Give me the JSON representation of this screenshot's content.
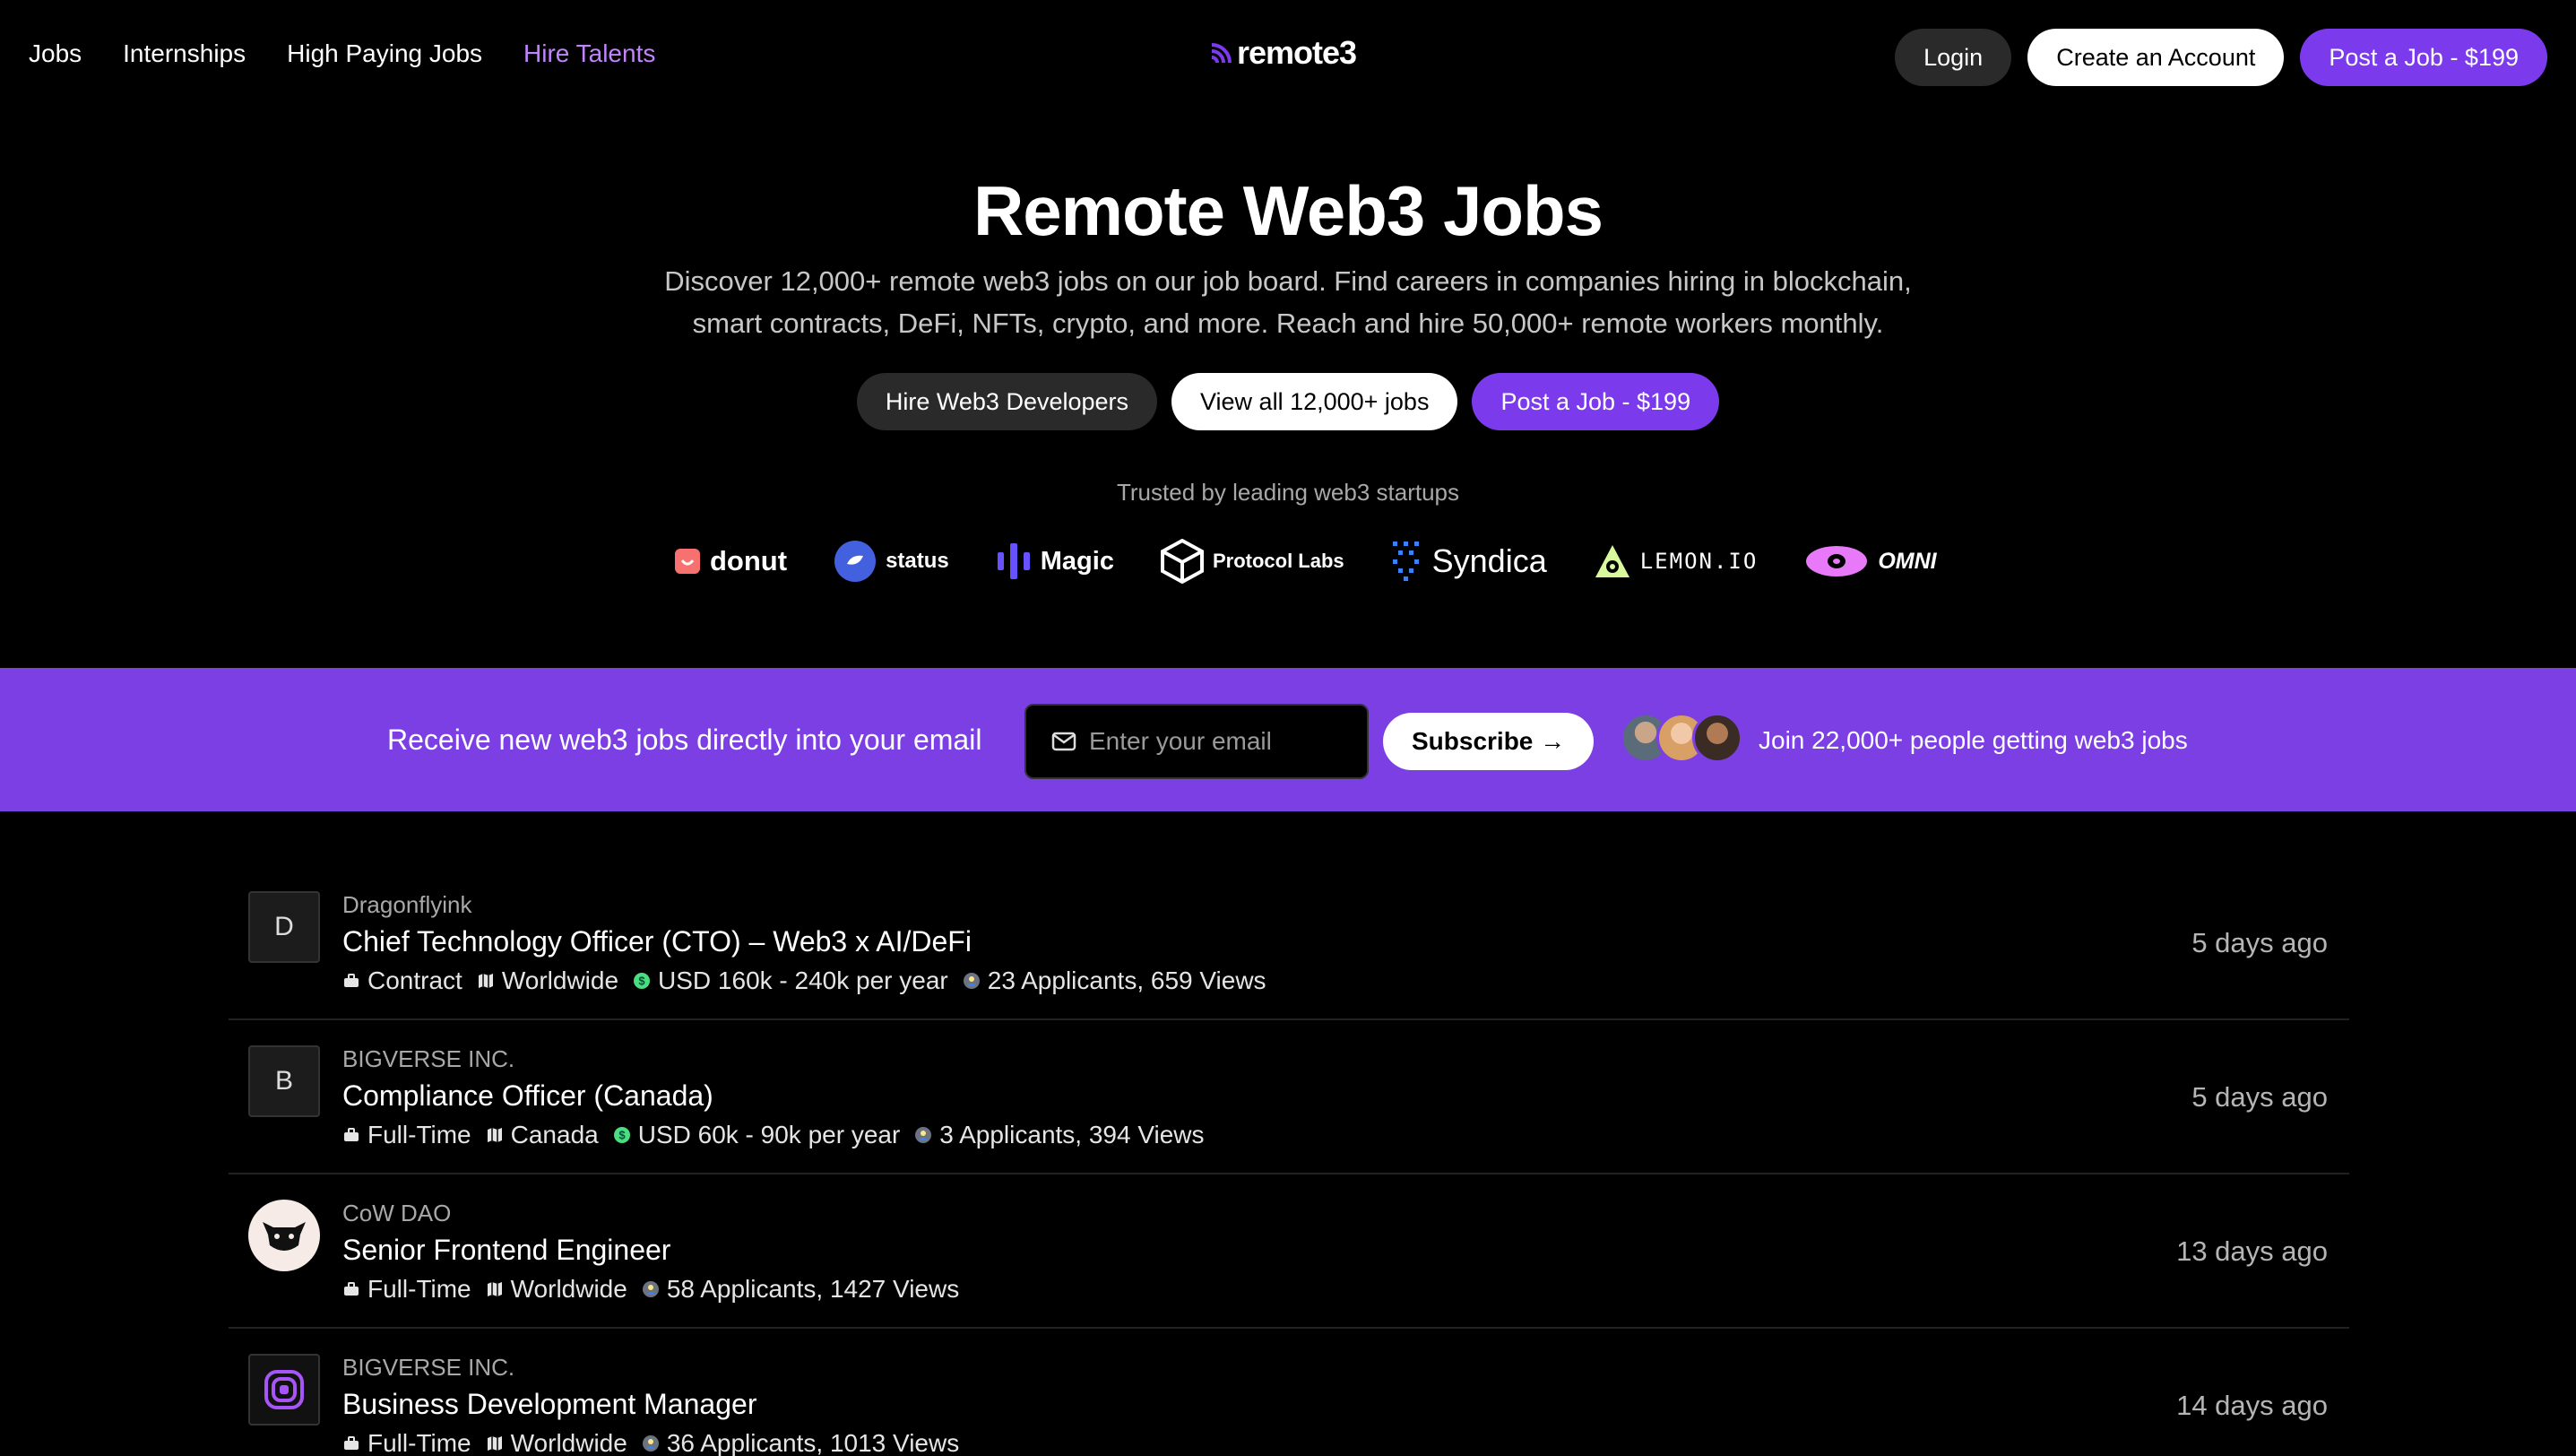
{
  "nav": {
    "links": [
      "Jobs",
      "Internships",
      "High Paying Jobs",
      "Hire Talents"
    ],
    "logo_text": "remote3",
    "login": "Login",
    "create_account": "Create an Account",
    "post_job": "Post a Job - $199"
  },
  "hero": {
    "title": "Remote Web3 Jobs",
    "subtitle_line1": "Discover 12,000+ remote web3 jobs on our job board. Find careers in companies hiring in blockchain,",
    "subtitle_line2": "smart contracts, DeFi, NFTs, crypto, and more. Reach and hire 50,000+ remote workers monthly.",
    "btn_hire": "Hire Web3 Developers",
    "btn_view": "View all 12,000+ jobs",
    "btn_post": "Post a Job - $199",
    "trusted": "Trusted by leading web3 startups",
    "brands": [
      "donut",
      "status",
      "Magic",
      "Protocol Labs",
      "Syndica",
      "LEMON.IO",
      "OMNI"
    ]
  },
  "newsletter": {
    "text": "Receive new web3 jobs directly into your email",
    "placeholder": "Enter your email",
    "subscribe": "Subscribe →",
    "join": "Join 22,000+ people getting web3 jobs"
  },
  "jobs": [
    {
      "logo_letter": "D",
      "company": "Dragonflyink",
      "title": "Chief Technology Officer (CTO) – Web3 x AI/DeFi",
      "type": "Contract",
      "location": "Worldwide",
      "salary": "USD 160k - 240k per year",
      "stats": "23 Applicants, 659 Views",
      "date": "5 days ago"
    },
    {
      "logo_letter": "B",
      "company": "BIGVERSE INC.",
      "title": "Compliance Officer (Canada)",
      "type": "Full-Time",
      "location": "Canada",
      "salary": "USD 60k - 90k per year",
      "stats": "3 Applicants, 394 Views",
      "date": "5 days ago"
    },
    {
      "logo_letter": "",
      "company": "CoW DAO",
      "title": "Senior Frontend Engineer",
      "type": "Full-Time",
      "location": "Worldwide",
      "salary": "",
      "stats": "58 Applicants, 1427 Views",
      "date": "13 days ago"
    },
    {
      "logo_letter": "",
      "company": "BIGVERSE INC.",
      "title": "Business Development Manager",
      "type": "Full-Time",
      "location": "Worldwide",
      "salary": "",
      "stats": "36 Applicants, 1013 Views",
      "date": "14 days ago"
    }
  ],
  "colors": {
    "accent": "#7c3aed",
    "newsletter_bg": "#7b3fe4",
    "nav_highlight": "#c084fc"
  }
}
